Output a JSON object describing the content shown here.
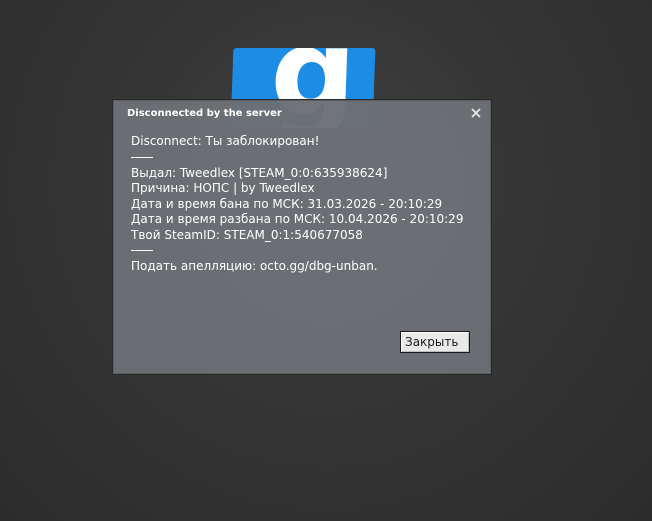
{
  "logo": {
    "letter": "g"
  },
  "dialog": {
    "title": "Disconnected by the server",
    "close_icon": "close-icon",
    "message": {
      "headline": "Disconnect: Ты заблокирован!",
      "separator_top": "___",
      "issued_by": "Выдал: Tweedlex [STEAM_0:0:635938624]",
      "reason": "Причина: НОПС | by Tweedlex",
      "ban_datetime": "Дата и время бана по МСК: 31.03.2026 - 20:10:29",
      "unban_datetime": "Дата и время разбана по МСК: 10.04.2026 - 20:10:29",
      "steam_id": "Твой SteamID: STEAM_0:1:540677058",
      "separator_bottom": "___",
      "appeal": "Подать апелляцию: octo.gg/dbg-unban."
    },
    "close_button_label": "Закрыть"
  },
  "colors": {
    "logo_blue": "#1c8ce4",
    "dialog_bg": "#6c6f74",
    "background": "#363636"
  }
}
